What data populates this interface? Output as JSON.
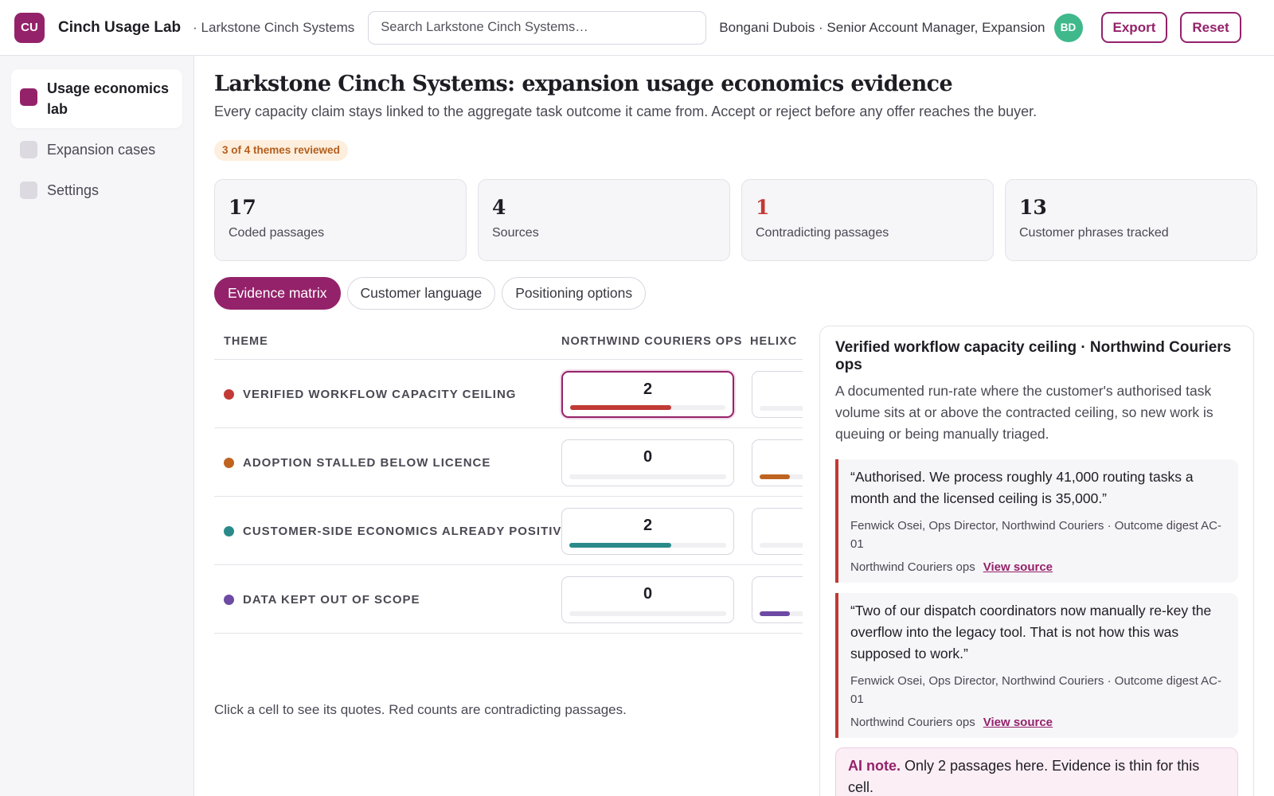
{
  "header": {
    "logo_initials": "CU",
    "app_name": "Cinch Usage Lab",
    "breadcrumb": "· Larkstone Cinch Systems",
    "search_placeholder": "Search Larkstone Cinch Systems…",
    "user": "Bongani Dubois · Senior Account Manager, Expansion",
    "avatar_initials": "BD",
    "export_label": "Export",
    "reset_label": "Reset"
  },
  "sidebar": {
    "items": [
      {
        "label": "Usage economics lab",
        "active": true
      },
      {
        "label": "Expansion cases",
        "active": false
      },
      {
        "label": "Settings",
        "active": false
      }
    ]
  },
  "page": {
    "title": "Larkstone Cinch Systems: expansion usage economics evidence",
    "subtitle": "Every capacity claim stays linked to the aggregate task outcome it came from. Accept or reject before any offer reaches the buyer.",
    "review_badge": "3 of 4 themes reviewed"
  },
  "stats": [
    {
      "value": "17",
      "label": "Coded passages"
    },
    {
      "value": "4",
      "label": "Sources"
    },
    {
      "value": "1",
      "label": "Contradicting passages"
    },
    {
      "value": "13",
      "label": "Customer phrases tracked"
    }
  ],
  "tabs": [
    {
      "label": "Evidence matrix",
      "active": true
    },
    {
      "label": "Customer language",
      "active": false
    },
    {
      "label": "Positioning options",
      "active": false
    }
  ],
  "matrix": {
    "col_theme": "THEME",
    "col_source1": "NORTHWIND COURIERS OPS",
    "col_source2": "HELIXC",
    "rows": [
      {
        "theme": "VERIFIED WORKFLOW CAPACITY CEILING",
        "color": "#c13a35",
        "count": "2",
        "fill": 0.65,
        "next_fill": 0,
        "selected": true
      },
      {
        "theme": "ADOPTION STALLED BELOW LICENCE",
        "color": "#bf6320",
        "count": "0",
        "fill": 0,
        "next_fill": 0.55,
        "selected": false
      },
      {
        "theme": "CUSTOMER-SIDE ECONOMICS ALREADY POSITIVE",
        "color": "#2a8a8a",
        "count": "2",
        "fill": 0.65,
        "next_fill": 0,
        "selected": false
      },
      {
        "theme": "DATA KEPT OUT OF SCOPE",
        "color": "#6d4aa3",
        "count": "0",
        "fill": 0,
        "next_fill": 0.55,
        "selected": false
      }
    ],
    "hint": "Click a cell to see its quotes. Red counts are contradicting passages."
  },
  "detail": {
    "title": "Verified workflow capacity ceiling · Northwind Couriers ops",
    "description": "A documented run-rate where the customer's authorised task volume sits at or above the contracted ceiling, so new work is queuing or being manually triaged.",
    "quotes": [
      {
        "text": "“Authorised. We process roughly 41,000 routing tasks a month and the licensed ceiling is 35,000.”",
        "attribution": "Fenwick Osei, Ops Director, Northwind Couriers · Outcome digest AC-01",
        "source": "Northwind Couriers ops",
        "link": "View source"
      },
      {
        "text": "“Two of our dispatch coordinators now manually re-key the overflow into the legacy tool. That is not how this was supposed to work.”",
        "attribution": "Fenwick Osei, Ops Director, Northwind Couriers · Outcome digest AC-01",
        "source": "Northwind Couriers ops",
        "link": "View source"
      }
    ],
    "ai_label": "AI note.",
    "ai_text": "Only 2 passages here. Evidence is thin for this cell."
  }
}
